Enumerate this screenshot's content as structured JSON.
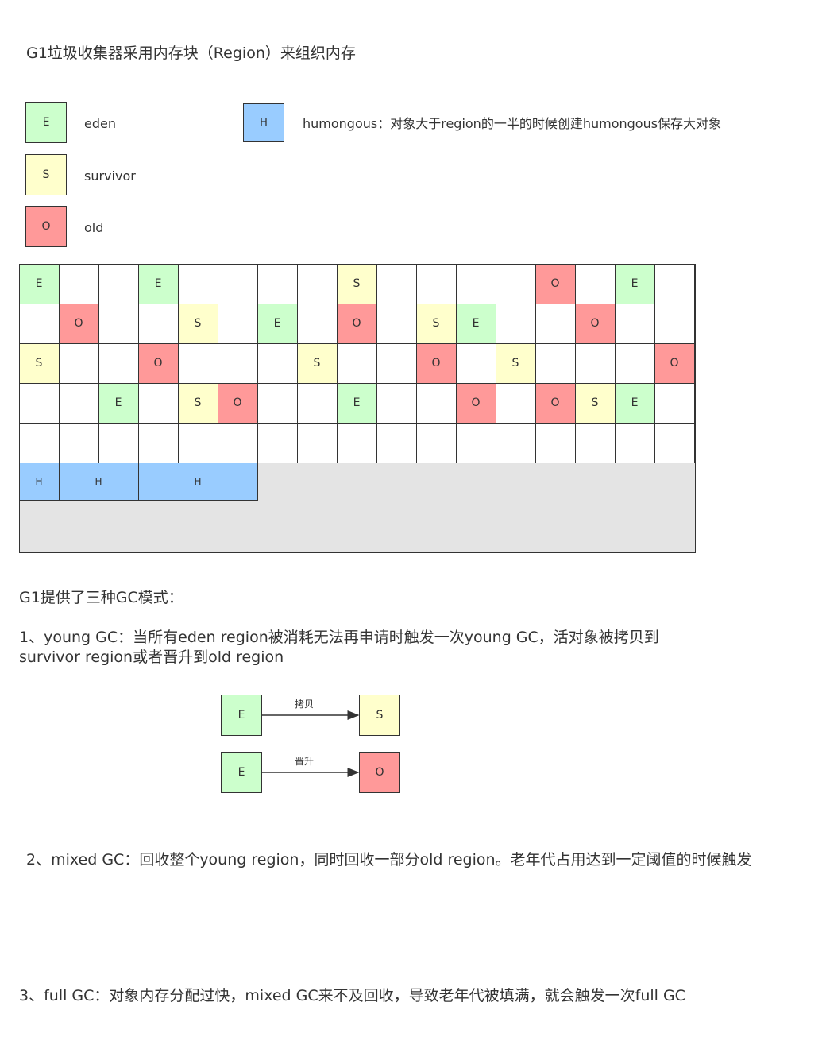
{
  "title": "G1垃圾收集器采用内存块（Region）来组织内存",
  "colors": {
    "E": "#ccffcc",
    "S": "#ffffcc",
    "O": "#ff9999",
    "H": "#99ccff"
  },
  "legend": {
    "eden": {
      "letter": "E",
      "label": "eden"
    },
    "survivor": {
      "letter": "S",
      "label": "survivor"
    },
    "old": {
      "letter": "O",
      "label": "old"
    },
    "humongous": {
      "letter": "H",
      "label": "humongous：对象大于region的一半的时候创建humongous保存大对象"
    }
  },
  "regions": [
    [
      "E",
      "",
      "",
      "E",
      "",
      "",
      "",
      "",
      "S",
      "",
      "",
      "",
      "",
      "O",
      "",
      "E",
      ""
    ],
    [
      "",
      "O",
      "",
      "",
      "S",
      "",
      "E",
      "",
      "O",
      "",
      "S",
      "E",
      "",
      "",
      "O",
      "",
      ""
    ],
    [
      "S",
      "",
      "",
      "O",
      "",
      "",
      "",
      "S",
      "",
      "",
      "O",
      "",
      "S",
      "",
      "",
      "",
      "O"
    ],
    [
      "",
      "",
      "E",
      "",
      "S",
      "O",
      "",
      "",
      "E",
      "",
      "",
      "O",
      "",
      "O",
      "S",
      "E",
      ""
    ],
    [
      "",
      "",
      "",
      "",
      "",
      "",
      "",
      "",
      "",
      "",
      "",
      "",
      "",
      "",
      "",
      "",
      ""
    ]
  ],
  "humongous_row": [
    "H",
    "H",
    "H"
  ],
  "modes_heading": "G1提供了三种GC模式：",
  "young_gc": {
    "line1": "1、young GC：当所有eden region被消耗无法再申请时触发一次young GC，活对象被拷贝到",
    "line2": "survivor region或者晋升到old region",
    "flow": [
      {
        "from": "E",
        "to": "S",
        "label": "拷贝"
      },
      {
        "from": "E",
        "to": "O",
        "label": "晋升"
      }
    ]
  },
  "mixed_gc": "2、mixed GC：回收整个young region，同时回收一部分old region。老年代占用达到一定阈值的时候触发",
  "full_gc": "3、full GC：对象内存分配过快，mixed GC来不及回收，导致老年代被填满，就会触发一次full GC"
}
